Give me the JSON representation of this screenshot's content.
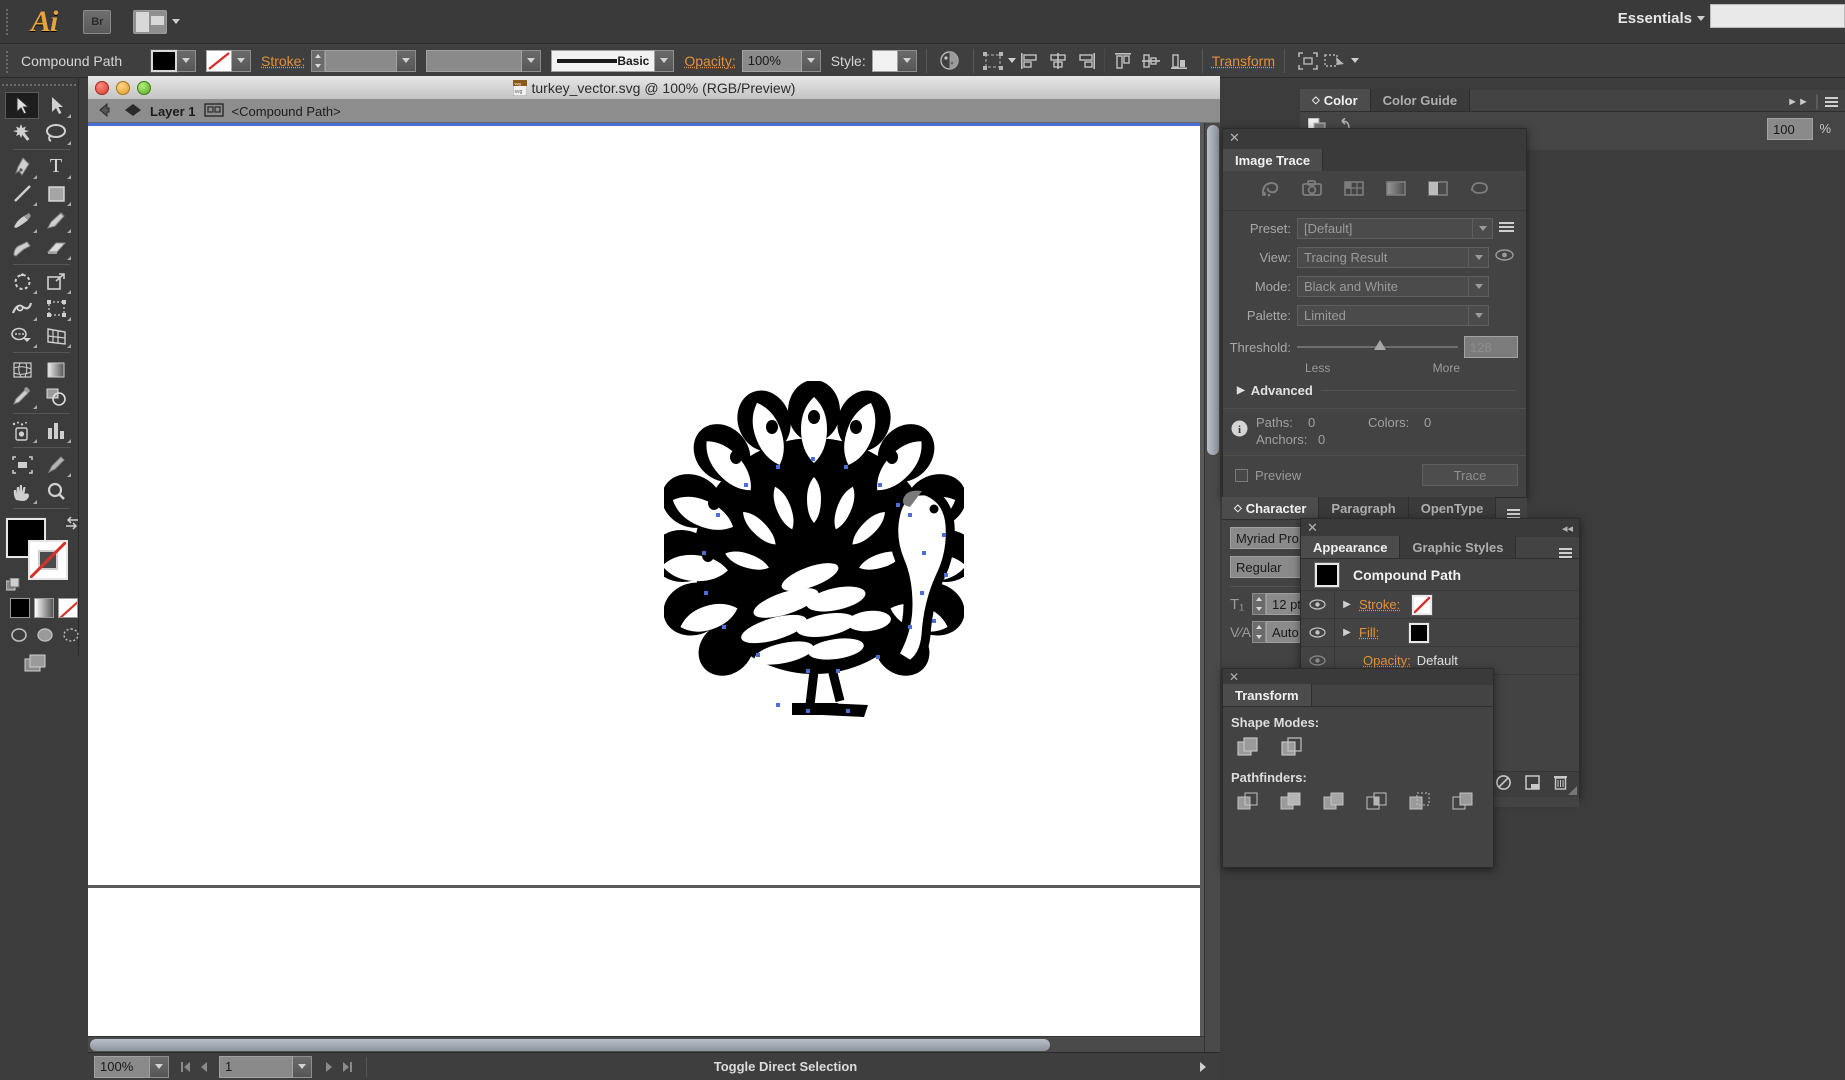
{
  "app": {
    "name": "Adobe Illustrator",
    "logo_text": "Ai",
    "bridge_label": "Br",
    "workspace": "Essentials",
    "search_placeholder": ""
  },
  "control_bar": {
    "object_label": "Compound Path",
    "fill_swatch": "#000000",
    "stroke_swatch": "none",
    "stroke_label": "Stroke:",
    "stroke_weight": "",
    "profile_value": "",
    "brush_label": "Basic",
    "opacity_label": "Opacity:",
    "opacity_value": "100%",
    "style_label": "Style:",
    "transform_label": "Transform",
    "align_icons": [
      "align-left-icon",
      "align-center-horizontal-icon",
      "align-right-icon",
      "align-top-icon",
      "align-center-vertical-icon",
      "align-bottom-icon"
    ],
    "extra_icons": [
      "isolate-icon",
      "draw-mode-icon"
    ]
  },
  "tools": {
    "rows": [
      [
        "selection-tool",
        "direct-selection-tool"
      ],
      [
        "magic-wand-tool",
        "lasso-tool"
      ],
      [
        "pen-tool",
        "type-tool"
      ],
      [
        "line-segment-tool",
        "rectangle-tool"
      ],
      [
        "paintbrush-tool",
        "pencil-tool"
      ],
      [
        "blob-brush-tool",
        "eraser-tool"
      ],
      [
        "rotate-tool",
        "scale-tool"
      ],
      [
        "width-tool",
        "free-transform-tool"
      ],
      [
        "shape-builder-tool",
        "perspective-grid-tool"
      ],
      [
        "mesh-tool",
        "gradient-tool"
      ],
      [
        "eyedropper-tool",
        "blend-tool"
      ],
      [
        "symbol-sprayer-tool",
        "column-graph-tool"
      ],
      [
        "artboard-tool",
        "slice-tool"
      ],
      [
        "hand-tool",
        "zoom-tool"
      ]
    ],
    "selected": "selection-tool",
    "fill_color": "#000000",
    "stroke_color": "none"
  },
  "document": {
    "title": "turkey_vector.svg @ 100% (RGB/Preview)",
    "file_icon": "svg-file-icon",
    "layer_name": "Layer 1",
    "selection_name": "<Compound Path>",
    "artwork": "turkey-vector-artwork",
    "selection_handle_color": "#4a6fd6"
  },
  "status_bar": {
    "zoom_value": "100%",
    "artboard_number": "1",
    "status_text": "Toggle Direct Selection"
  },
  "color_panel": {
    "tabs": [
      "Color",
      "Color Guide"
    ],
    "active_tab": "Color",
    "tint_value": "100",
    "percent_symbol": "%"
  },
  "image_trace": {
    "title": "Image Trace",
    "close_icon": "close-icon",
    "mode_icons": [
      "auto-color-icon",
      "high-color-icon",
      "low-color-icon",
      "grayscale-icon",
      "black-white-icon",
      "outline-icon"
    ],
    "fields": [
      {
        "label": "Preset:",
        "value": "[Default]"
      },
      {
        "label": "View:",
        "value": "Tracing Result"
      },
      {
        "label": "Mode:",
        "value": "Black and White"
      },
      {
        "label": "Palette:",
        "value": "Limited"
      }
    ],
    "threshold_label": "Threshold:",
    "threshold_value": "128",
    "threshold_less": "Less",
    "threshold_more": "More",
    "advanced_label": "Advanced",
    "stats": {
      "paths_label": "Paths:",
      "paths_value": "0",
      "colors_label": "Colors:",
      "colors_value": "0",
      "anchors_label": "Anchors:",
      "anchors_value": "0"
    },
    "preview_label": "Preview",
    "preview_checked": false,
    "trace_button": "Trace"
  },
  "character_panel": {
    "tabs": [
      "Character",
      "Paragraph",
      "OpenType"
    ],
    "active_tab": "Character",
    "font_family": "Myriad Pro",
    "font_style": "Regular",
    "font_size": "12 pt",
    "leading": "Auto"
  },
  "appearance_panel": {
    "close_icon": "close-icon",
    "tabs": [
      "Appearance",
      "Graphic Styles"
    ],
    "active_tab": "Appearance",
    "object_name": "Compound Path",
    "object_swatch": "#000000",
    "rows": [
      {
        "label": "Stroke:",
        "swatch": "none",
        "visible": true
      },
      {
        "label": "Fill:",
        "swatch": "#000000",
        "visible": true
      }
    ],
    "opacity_label": "Opacity:",
    "opacity_value": "Default",
    "footer_icons": [
      "add-new-stroke-icon",
      "add-new-fill-icon",
      "add-effect-icon",
      "clear-appearance-icon",
      "duplicate-item-icon",
      "delete-item-icon"
    ]
  },
  "pathfinder_panel": {
    "close_icon": "close-icon",
    "tab": "Transform",
    "shape_modes_label": "Shape Modes:",
    "shape_mode_icons": [
      "unite-icon",
      "minus-front-icon"
    ],
    "pathfinders_label": "Pathfinders:",
    "pathfinder_icons": [
      "divide-icon",
      "trim-icon",
      "merge-icon",
      "crop-icon",
      "outline-icon",
      "minus-back-icon"
    ]
  }
}
